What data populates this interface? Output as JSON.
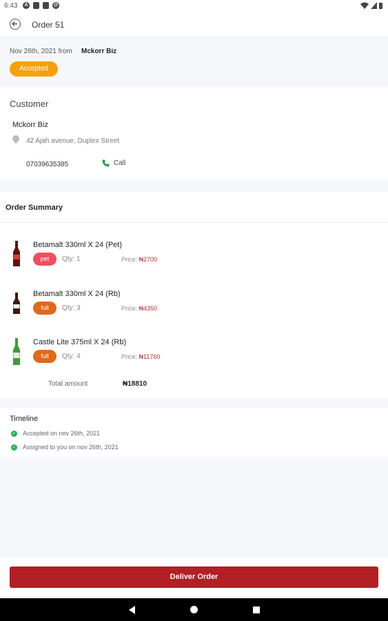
{
  "status_bar": {
    "time": "6:43"
  },
  "app_bar": {
    "title": "Order 51"
  },
  "order": {
    "date": "Nov 26th, 2021 from",
    "from": "Mckorr Biz",
    "status": "Accepted",
    "status_color": "#f6a10c"
  },
  "customer": {
    "heading": "Customer",
    "name": "Mckorr Biz",
    "address": "42 Ajah avenue, Duplex Street",
    "phone": "07039635385",
    "call_label": "Call"
  },
  "summary": {
    "heading": "Order Summary",
    "items": [
      {
        "name": "Betamalt 330ml X 24 (Pet)",
        "type": "pet",
        "type_color": "#f04e5e",
        "qty": "Qty: 1",
        "price_label": "Price:",
        "price": "₦2700",
        "bottle_color": "#5a1414"
      },
      {
        "name": "Betamalt 330ml X 24 (Rb)",
        "type": "full",
        "type_color": "#e0691a",
        "qty": "Qty: 3",
        "price_label": "Price:",
        "price": "₦4350",
        "bottle_color": "#3b1a12"
      },
      {
        "name": "Castle Lite 375ml X 24 (Rb)",
        "type": "full",
        "type_color": "#e0691a",
        "qty": "Qty: 4",
        "price_label": "Price:",
        "price": "₦11760",
        "bottle_color": "#3f9a3a"
      }
    ],
    "total_label": "Total amount",
    "total_value": "₦18810"
  },
  "timeline": {
    "heading": "Timeline",
    "events": [
      "Accepted on nov 26th, 2021",
      "Assigned to you on nov 26th, 2021"
    ]
  },
  "actions": {
    "deliver_label": "Deliver Order",
    "deliver_color": "#b21f24"
  }
}
